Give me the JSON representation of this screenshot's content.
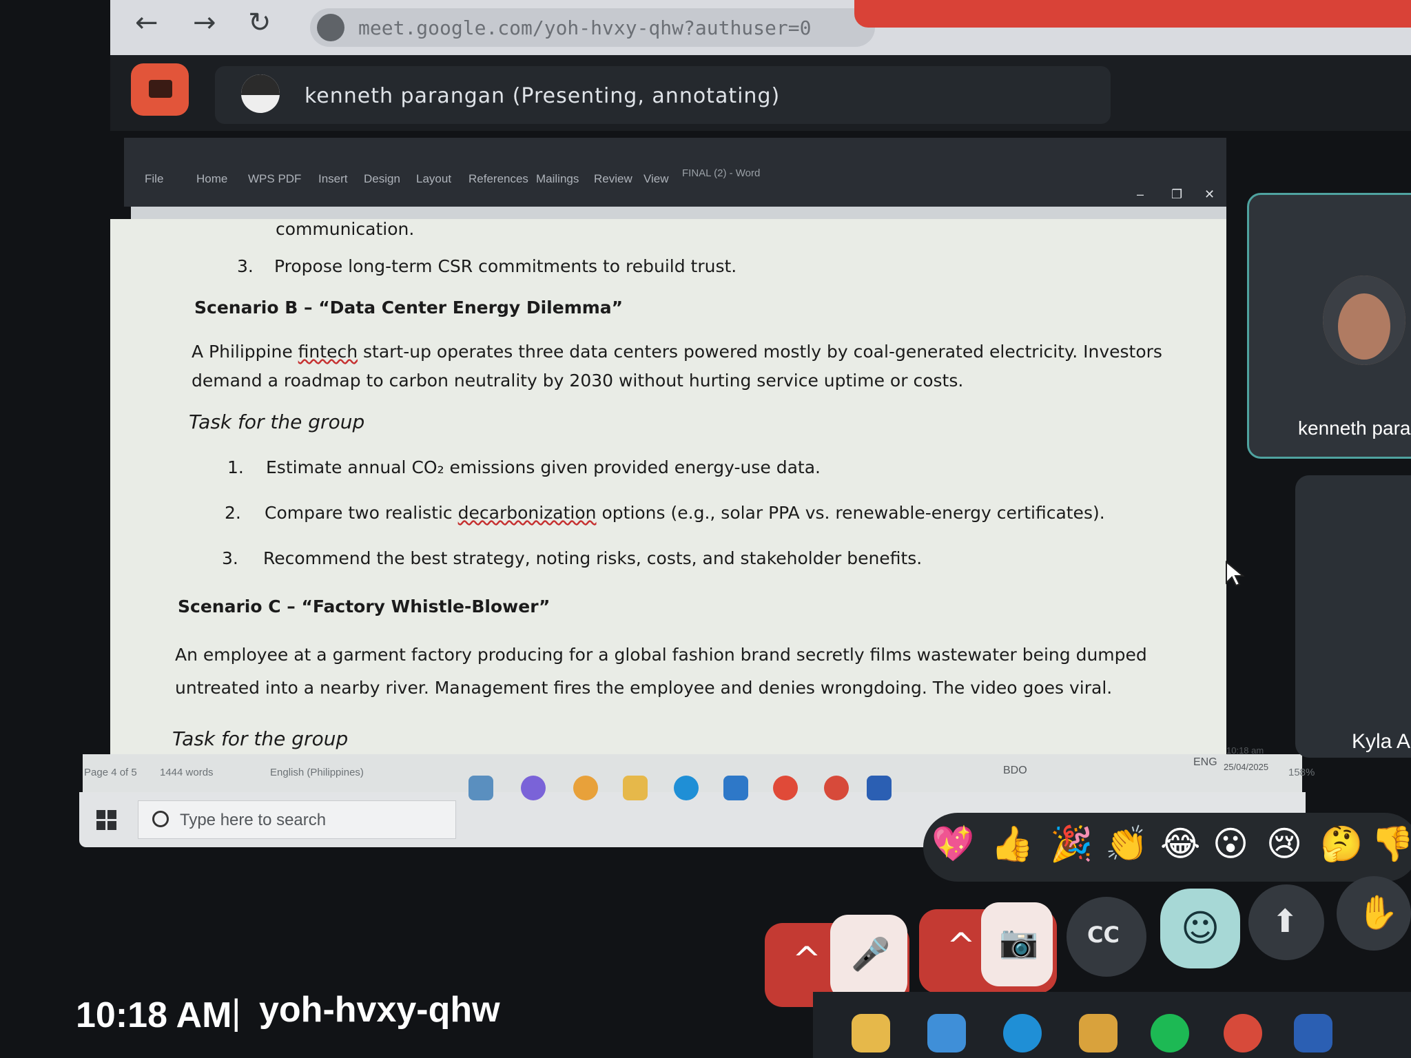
{
  "browser": {
    "url": "meet.google.com/yoh-hvxy-qhw?authuser=0",
    "back_glyph": "←",
    "forward_glyph": "→",
    "reload_glyph": "↻"
  },
  "meet": {
    "presenter_label": "kenneth parangan (Presenting, annotating)",
    "meeting_time": "10:18 AM",
    "separator": "|",
    "meeting_code": "yoh-hvxy-qhw",
    "participants": [
      {
        "name": "kenneth para"
      },
      {
        "name": "Kyla A"
      }
    ],
    "reactions": [
      "💖",
      "👍",
      "🎉",
      "👏",
      "😂",
      "😮",
      "😢",
      "🤔",
      "👎"
    ],
    "controls": {
      "mic_glyph": "🎤",
      "cam_glyph": "📷",
      "cc_label": "CC",
      "emoji_glyph": "☺",
      "present_glyph": "⬆",
      "hand_glyph": "✋",
      "chevron": "^"
    },
    "accent_red": "#c43a33",
    "accent_teal": "#a7d8d6"
  },
  "word": {
    "ribbon_tabs": [
      "File",
      "Home",
      "WPS PDF",
      "Insert",
      "Design",
      "Layout",
      "References",
      "Mailings",
      "Review",
      "View"
    ],
    "title": "FINAL (2) - Word",
    "status": {
      "page": "Page 4 of 5",
      "words": "1444 words",
      "language": "English (Philippines)",
      "zoom": "158%"
    },
    "document": {
      "line_communication": "communication.",
      "a_item3_num": "3.",
      "a_item3": "Propose long-term CSR commitments to rebuild trust.",
      "scenario_b_title": "Scenario B – “Data Center Energy Dilemma”",
      "scenario_b_p1a": "A Philippine ",
      "scenario_b_p1_fintech": "fintech",
      "scenario_b_p1b": " start-up operates three data centers powered mostly by coal-generated electricity. Investors",
      "scenario_b_p2": "demand a roadmap to carbon neutrality by 2030 without hurting service uptime or costs.",
      "task_label": "Task for the group",
      "b_item1_num": "1.",
      "b_item1": "Estimate annual CO₂ emissions given provided energy-use data.",
      "b_item2_num": "2.",
      "b_item2a": "Compare two realistic ",
      "b_item2_decarb": "decarbonization",
      "b_item2b": " options (e.g., solar PPA vs. renewable-energy certificates).",
      "b_item3_num": "3.",
      "b_item3": "Recommend the best strategy, noting risks, costs, and stakeholder benefits.",
      "scenario_c_title": "Scenario C – “Factory Whistle-Blower”",
      "scenario_c_p1": "An employee at a garment factory producing for a global fashion brand secretly films wastewater being dumped",
      "scenario_c_p2": "untreated into a nearby river. Management fires the employee and denies wrongdoing. The video goes viral.",
      "task_label_2": "Task for the group"
    }
  },
  "inner_taskbar": {
    "search_placeholder": "Type here to search",
    "tray_bdo": "BDO",
    "tray_lang": "ENG",
    "clock_time": "10:18 am",
    "clock_date": "25/04/2025"
  }
}
